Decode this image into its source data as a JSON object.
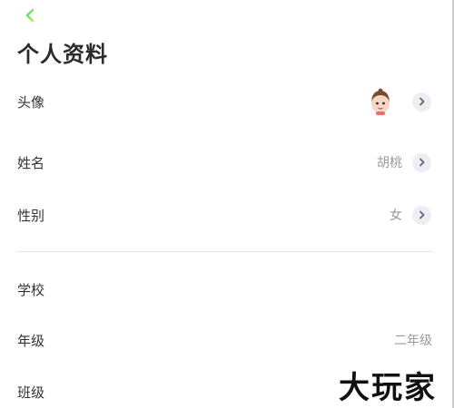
{
  "header": {
    "back_icon": "chevron-left-icon",
    "title": "个人资料"
  },
  "accent_color": "#2ed573",
  "profile_rows": [
    {
      "label": "头像",
      "value_type": "avatar",
      "has_arrow": true
    },
    {
      "label": "姓名",
      "value": "胡桃",
      "has_arrow": true
    },
    {
      "label": "性别",
      "value": "女",
      "has_arrow": true
    }
  ],
  "school_rows": [
    {
      "label": "学校",
      "value": ""
    },
    {
      "label": "年级",
      "value": "二年级"
    },
    {
      "label": "班级",
      "value": ""
    }
  ],
  "watermark": "大玩家"
}
